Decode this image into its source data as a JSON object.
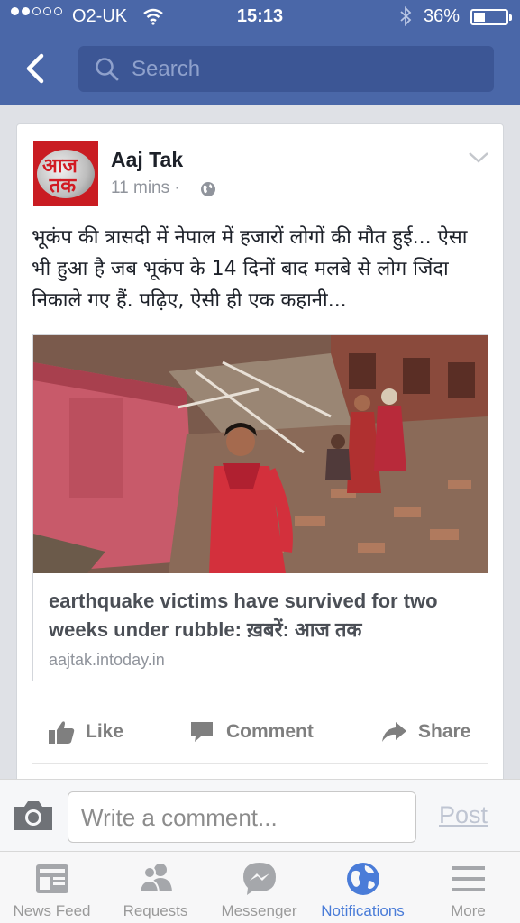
{
  "status_bar": {
    "carrier": "O2-UK",
    "time": "15:13",
    "battery": "36%",
    "battery_level": 0.36
  },
  "search": {
    "placeholder": "Search"
  },
  "post": {
    "author": "Aaj Tak",
    "time_ago": "11 mins ·",
    "text": "भूकंप की त्रासदी में नेपाल में हजारों लोगों की मौत हुई... ऐसा भी हुआ है जब भूकंप के 14 दिनों बाद मलबे से लोग जिंदा निकाले गए हैं. पढ़िए, ऐसी ही एक कहानी...",
    "avatar_text": "आज तक",
    "link": {
      "title": "earthquake victims have survived for two weeks under rubble: ख़बरें: आज तक",
      "domain": "aajtak.intoday.in"
    }
  },
  "actions": {
    "like": "Like",
    "comment": "Comment",
    "share": "Share"
  },
  "comment_bar": {
    "placeholder": "Write a comment...",
    "post": "Post"
  },
  "tabs": [
    {
      "label": "News Feed",
      "icon": "news-feed-icon"
    },
    {
      "label": "Requests",
      "icon": "friends-icon"
    },
    {
      "label": "Messenger",
      "icon": "messenger-icon"
    },
    {
      "label": "Notifications",
      "icon": "globe-icon",
      "active": true
    },
    {
      "label": "More",
      "icon": "menu-icon"
    }
  ],
  "colors": {
    "header": "#4a67a8",
    "active_tab": "#4a7cd8"
  }
}
